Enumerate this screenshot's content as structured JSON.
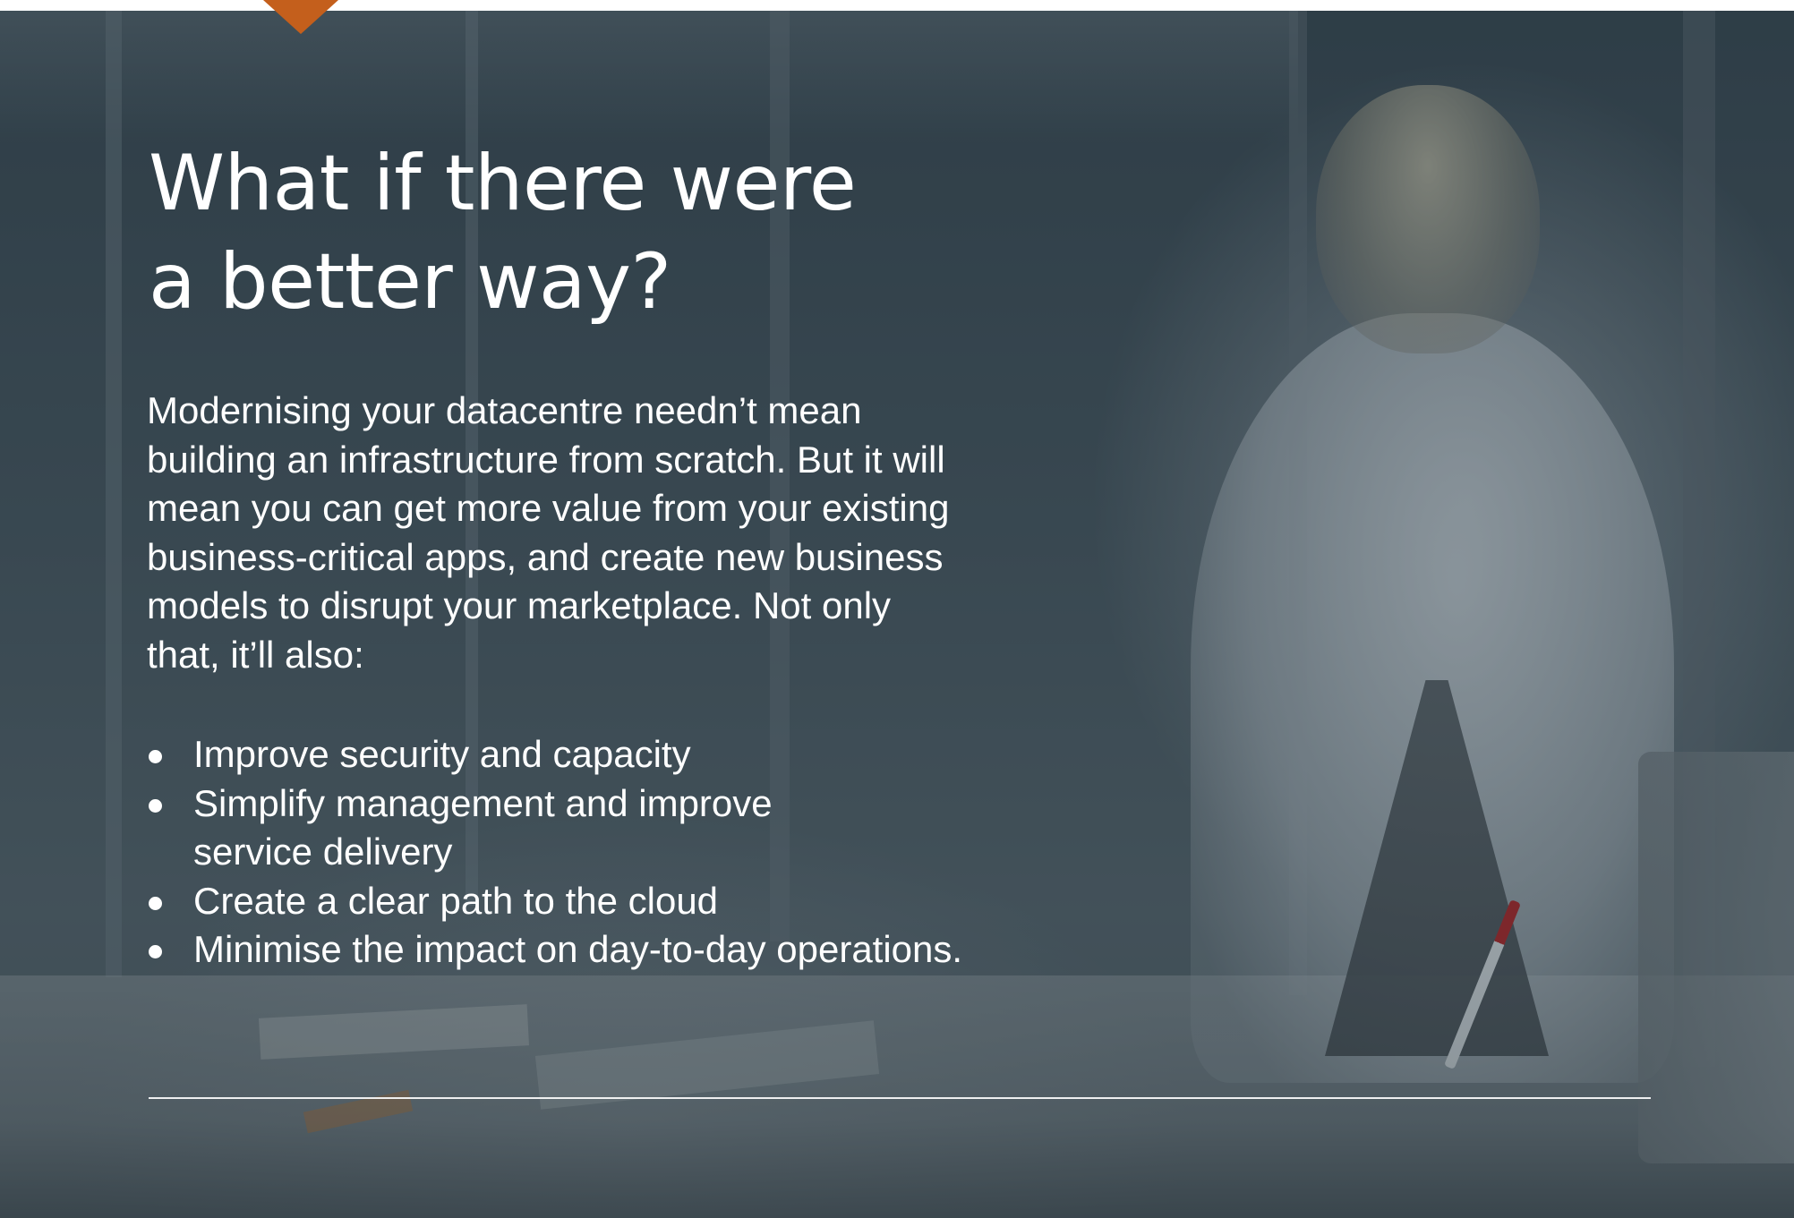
{
  "colors": {
    "accent": "#c45f1c",
    "text": "#ffffff",
    "overlay": "#26343e"
  },
  "heading": {
    "line1": "What if there were",
    "line2": "a better way?"
  },
  "intro": {
    "lines": [
      "Modernising your datacentre needn’t mean",
      "building an infrastructure from scratch. But it will",
      "mean you can get more value from your existing",
      "business-critical apps, and create new business",
      "models to disrupt your marketplace. Not only",
      "that, it’ll also:"
    ]
  },
  "benefits": [
    {
      "lines": [
        "Improve security and capacity"
      ]
    },
    {
      "lines": [
        "Simplify management and improve",
        "service delivery"
      ]
    },
    {
      "lines": [
        "Create a clear path to the cloud"
      ]
    },
    {
      "lines": [
        "Minimise the impact on day-to-day operations."
      ]
    }
  ]
}
